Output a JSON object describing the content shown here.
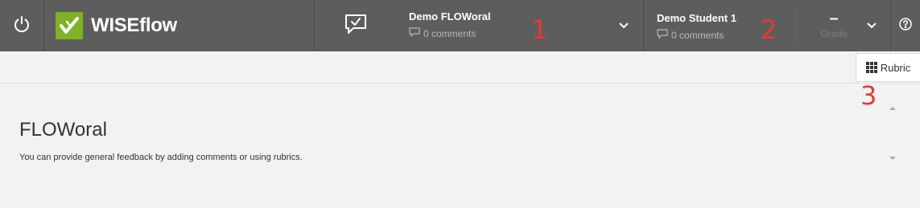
{
  "brand": {
    "name": "WISEflow",
    "color": "#7fb12a"
  },
  "header": {
    "flow": {
      "title": "Demo FLOWoral",
      "comments": "0 comments"
    },
    "student": {
      "title": "Demo Student 1",
      "comments": "0 comments"
    },
    "grade": {
      "value": "–",
      "label": "Grade"
    },
    "icons": {
      "power": "power-icon",
      "feedback": "speech-bubble-check-icon",
      "comment": "comment-bubble-icon",
      "chevron": "chevron-down-icon",
      "help": "help-circle-icon"
    }
  },
  "markers": {
    "one": "1",
    "two": "2",
    "three": "3"
  },
  "toolbar": {
    "rubric_label": "Rubric",
    "rubric_icon": "grid-icon"
  },
  "main": {
    "title": "FLOWoral",
    "description": "You can provide general feedback by adding comments or using rubrics."
  }
}
